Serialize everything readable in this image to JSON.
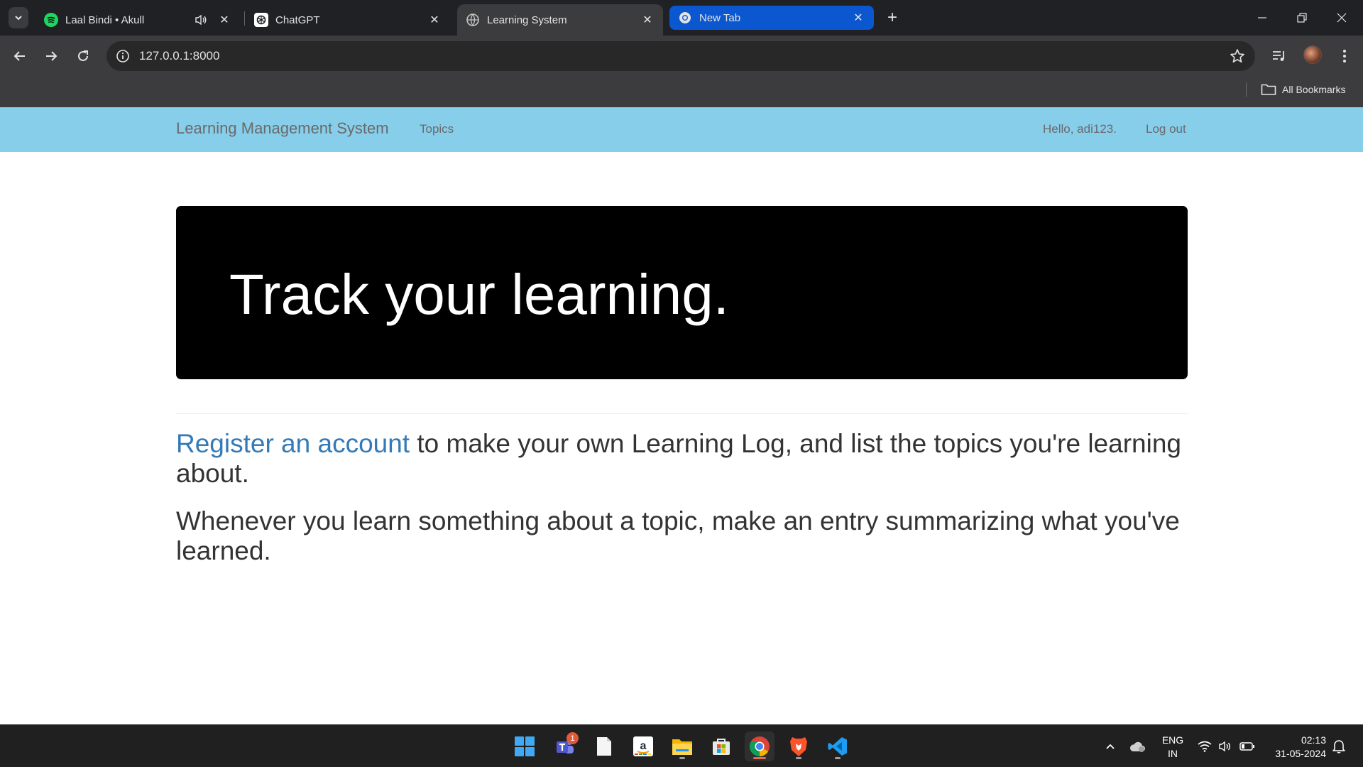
{
  "browser": {
    "tabs": [
      {
        "title": "Laal Bindi • Akull",
        "favicon": "spotify-icon",
        "audio": true
      },
      {
        "title": "ChatGPT",
        "favicon": "chatgpt-icon"
      },
      {
        "title": "Learning System",
        "favicon": "globe-icon",
        "active": true
      },
      {
        "title": "New Tab",
        "favicon": "chrome-icon",
        "highlighted": true
      }
    ],
    "url": "127.0.0.1:8000",
    "bookmarks_label": "All Bookmarks"
  },
  "site": {
    "brand": "Learning Management System",
    "nav_topics": "Topics",
    "greeting": "Hello, adi123.",
    "logout": "Log out"
  },
  "main": {
    "heading": "Track your learning.",
    "register_link": "Register an account",
    "p1_rest": " to make your own Learning Log, and list the topics you're learning about.",
    "p2": "Whenever you learn something about a topic, make an entry summarizing what you've learned."
  },
  "taskbar": {
    "apps": [
      "windows-start",
      "teams",
      "notepad",
      "amazon",
      "file-explorer",
      "microsoft-store",
      "chrome",
      "brave",
      "vscode"
    ],
    "teams_badge": "1",
    "lang_line1": "ENG",
    "lang_line2": "IN",
    "time": "02:13",
    "date": "31-05-2024"
  },
  "colors": {
    "navbar": "#87ceeb",
    "jumbotron": "#000000",
    "link": "#337ab7",
    "chrome_dark": "#202124",
    "new_tab_highlight": "#0b57d0"
  }
}
